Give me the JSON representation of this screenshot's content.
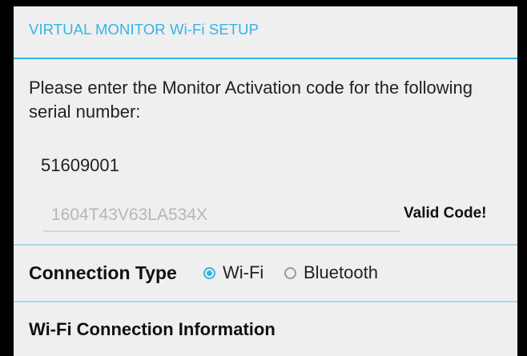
{
  "dialog": {
    "title": "VIRTUAL MONITOR Wi-Fi SETUP",
    "instruction": "Please enter the Monitor Activation code for the following serial number:",
    "serial_number": "51609001",
    "activation_code": {
      "value": "1604T43V63LA534X",
      "status": "Valid Code!"
    },
    "connection": {
      "label": "Connection Type",
      "options": [
        {
          "label": "Wi-Fi",
          "selected": true
        },
        {
          "label": "Bluetooth",
          "selected": false
        }
      ]
    },
    "wifi_section_title": "Wi-Fi Connection Information"
  },
  "colors": {
    "accent": "#33b5e5",
    "background": "#efefef"
  }
}
